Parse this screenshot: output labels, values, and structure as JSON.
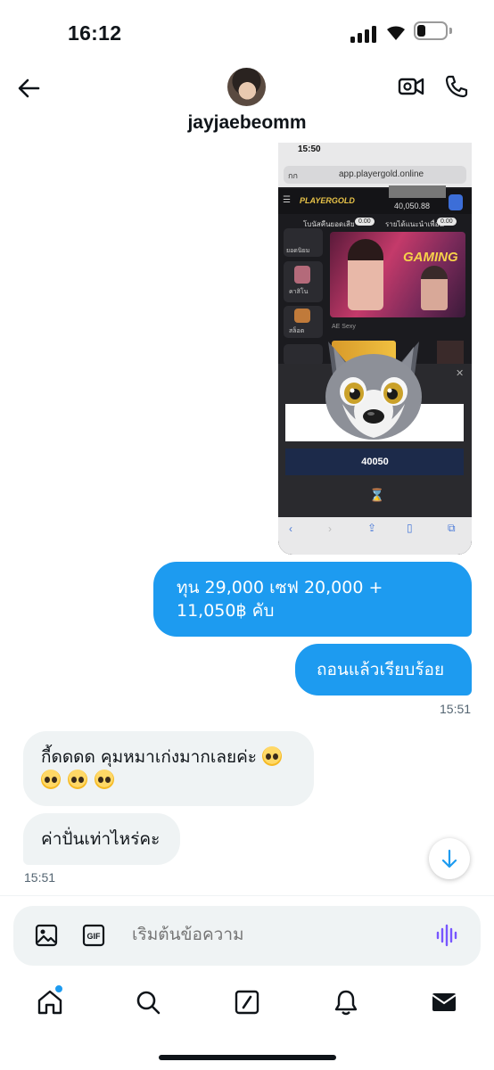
{
  "status_bar": {
    "time": "16:12"
  },
  "header": {
    "username": "jayjaebeomm"
  },
  "shared_screenshot": {
    "time": "15:50",
    "address_prefix": "กก",
    "url": "app.playergold.online",
    "logo": "PLAYERGOLD",
    "balance": "40,050.88",
    "promo_left": "โบนัสคืนยอดเสีย",
    "promo_left_value": "0.00",
    "promo_right": "รายได้แนะนำเพื่อน",
    "promo_right_value": "0.00",
    "side_items": [
      "ยอดนิยม",
      "คาสิโน",
      "สล็อต"
    ],
    "banner_text": "GAMING",
    "banner_caption": "AE Sexy",
    "amount": "40050"
  },
  "messages": [
    {
      "dir": "out",
      "text": "ทุน 29,000 เซฟ 20,000 + 11,050฿ คับ"
    },
    {
      "dir": "out",
      "text": "ถอนแล้วเรียบร้อย"
    },
    {
      "dir": "in",
      "text": "กี้ดดดด คุมหมาเก่งมากเลยค่ะ"
    },
    {
      "dir": "in",
      "text": "ค่าปั่นเท่าไหร่คะ"
    }
  ],
  "timestamps": {
    "outgoing": "15:51",
    "incoming": "15:51"
  },
  "composer": {
    "placeholder": "เริ่มต้นข้อความ"
  },
  "colors": {
    "accent": "#1d9bf0",
    "incoming_bubble": "#eff3f4",
    "voice_icon": "#7856ff"
  },
  "icons": [
    "back-arrow-icon",
    "video-call-icon",
    "phone-icon",
    "image-icon",
    "gif-icon",
    "voice-icon",
    "home-icon",
    "search-icon",
    "compose-icon",
    "bell-icon",
    "mail-icon",
    "arrow-down-icon"
  ]
}
